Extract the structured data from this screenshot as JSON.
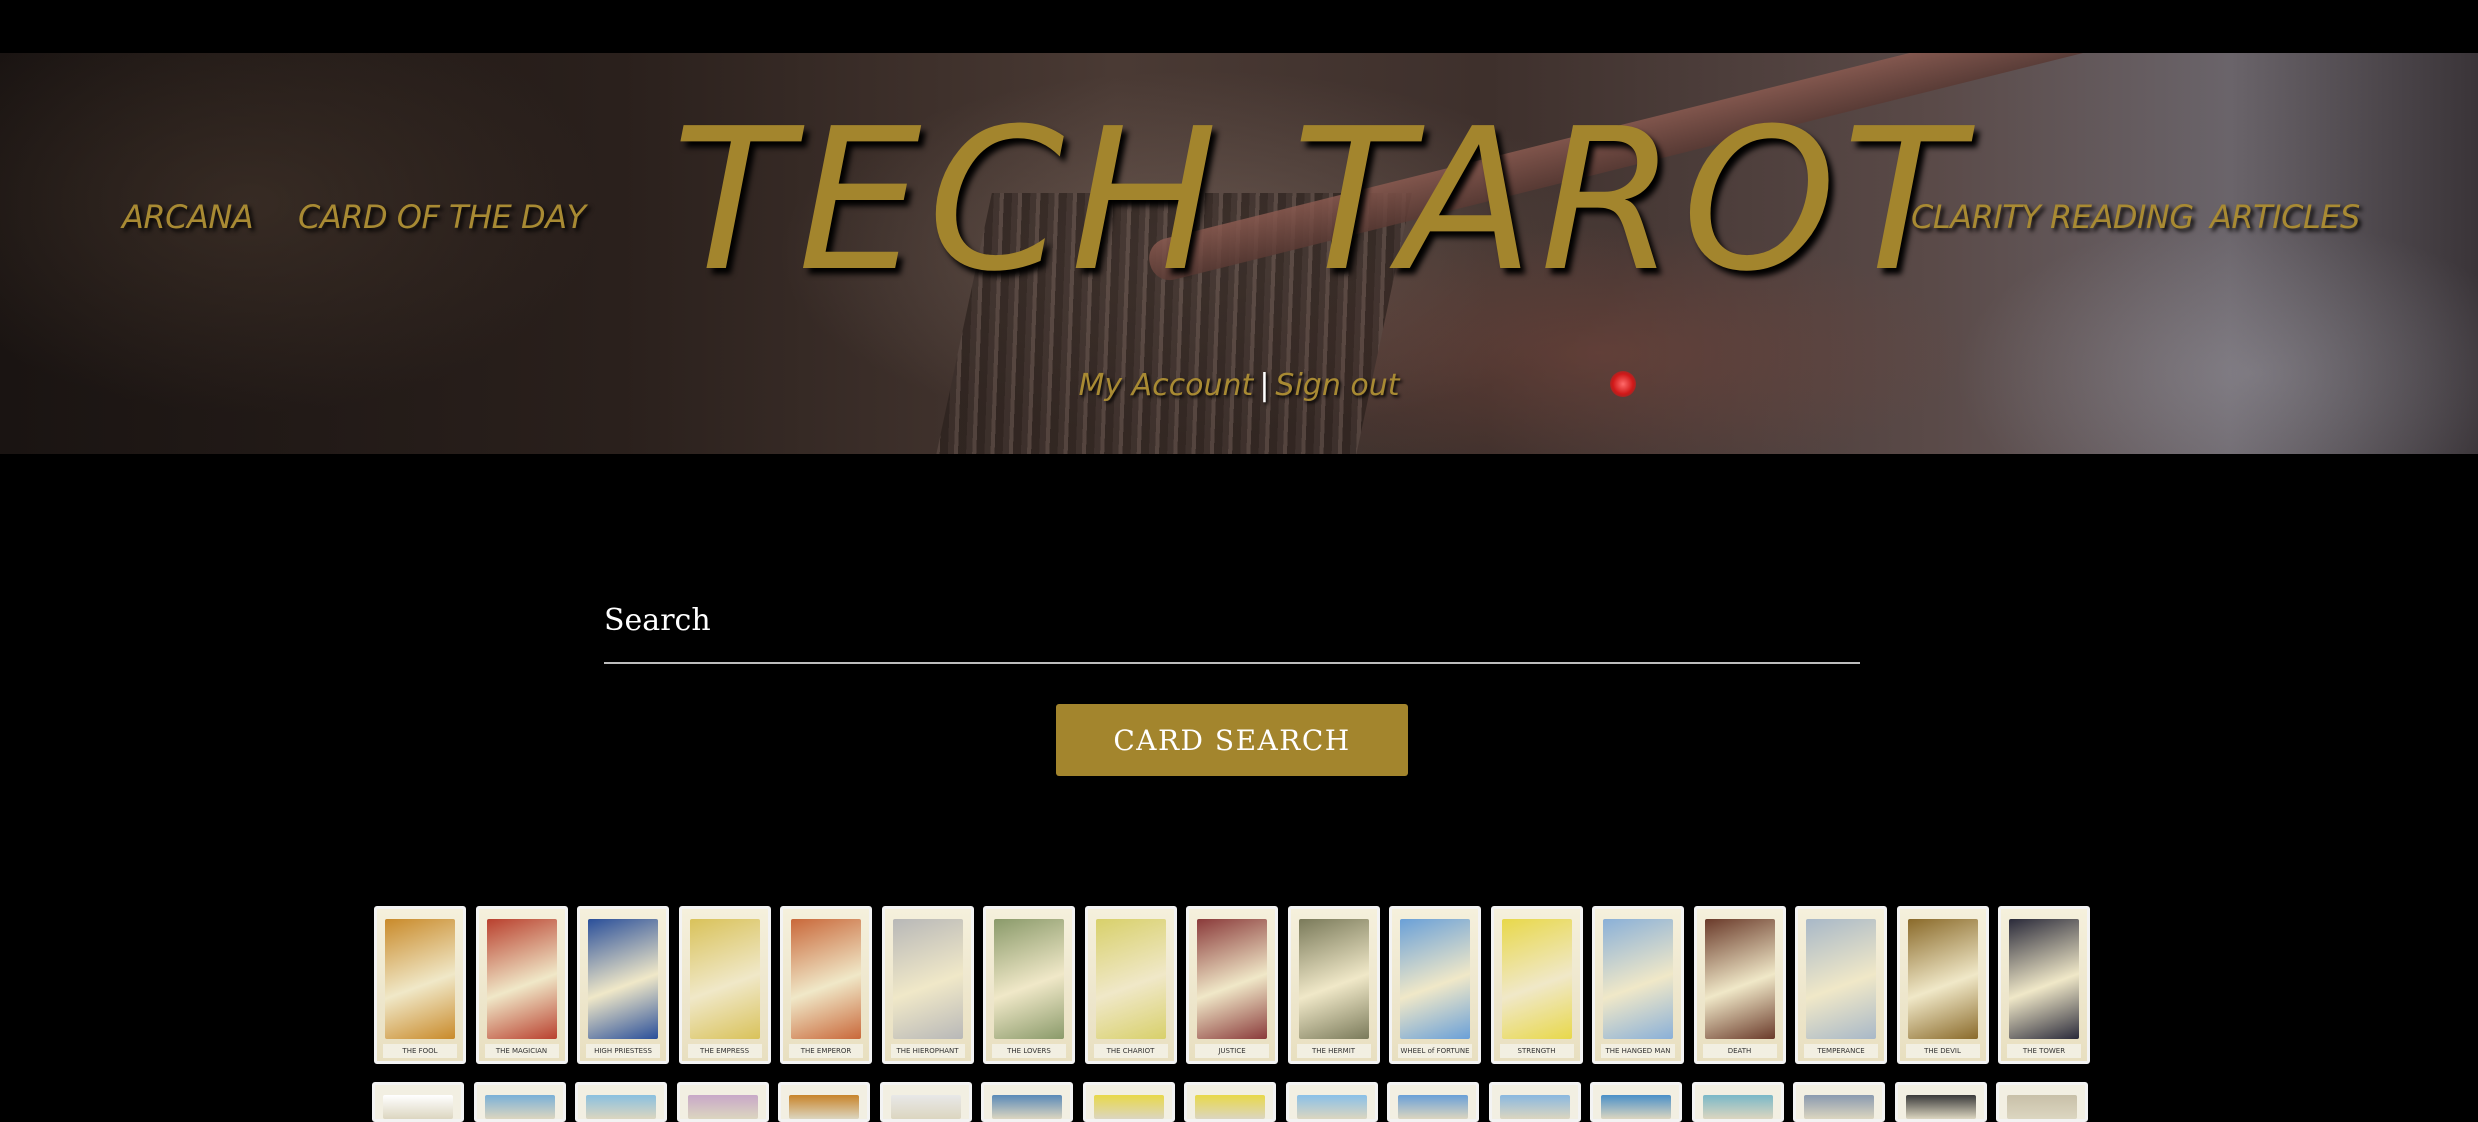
{
  "header": {
    "logo": "TECH TAROT",
    "nav_left": [
      "ARCANA",
      "CARD OF THE DAY"
    ],
    "nav_right": [
      "CLARITY READING",
      "ARTICLES"
    ],
    "account_link": "My Account",
    "account_separator": "|",
    "signout_link": "Sign out"
  },
  "search": {
    "placeholder": "Search",
    "button_label": "CARD SEARCH"
  },
  "colors": {
    "accent": "#a3852d",
    "background": "#000000"
  },
  "cards_row1": [
    {
      "caption": "THE FOOL",
      "tone": "#c98a2a"
    },
    {
      "caption": "THE MAGICIAN",
      "tone": "#b9402e"
    },
    {
      "caption": "HIGH PRIESTESS",
      "tone": "#2a4f9a"
    },
    {
      "caption": "THE EMPRESS",
      "tone": "#d9c25a"
    },
    {
      "caption": "THE EMPEROR",
      "tone": "#c9683a"
    },
    {
      "caption": "THE HIEROPHANT",
      "tone": "#b8b8b8"
    },
    {
      "caption": "THE LOVERS",
      "tone": "#8a9a6a"
    },
    {
      "caption": "THE CHARIOT",
      "tone": "#d8d06a"
    },
    {
      "caption": "JUSTICE",
      "tone": "#8a3a3a"
    },
    {
      "caption": "THE HERMIT",
      "tone": "#7a7a5a"
    },
    {
      "caption": "WHEEL of FORTUNE",
      "tone": "#6aa0d8"
    },
    {
      "caption": "STRENGTH",
      "tone": "#e8d84a"
    },
    {
      "caption": "THE HANGED MAN",
      "tone": "#8ab0d8"
    },
    {
      "caption": "DEATH",
      "tone": "#6a3a2a"
    },
    {
      "caption": "TEMPERANCE",
      "tone": "#a8b8c8"
    },
    {
      "caption": "THE DEVIL",
      "tone": "#8a6a2a"
    },
    {
      "caption": "THE TOWER",
      "tone": "#2a2a3a"
    }
  ],
  "cards_row2": [
    {
      "tone": "#ffffff"
    },
    {
      "tone": "#7ab0d8"
    },
    {
      "tone": "#8ac0e0"
    },
    {
      "tone": "#c8a8c8"
    },
    {
      "tone": "#c8842a"
    },
    {
      "tone": "#e8e8e8"
    },
    {
      "tone": "#5a8ab8"
    },
    {
      "tone": "#e8d84a"
    },
    {
      "tone": "#e8d84a"
    },
    {
      "tone": "#8ac0e8"
    },
    {
      "tone": "#6aa0d8"
    },
    {
      "tone": "#8ab8e0"
    },
    {
      "tone": "#4a90c8"
    },
    {
      "tone": "#7ab8c8"
    },
    {
      "tone": "#8a9ab0"
    },
    {
      "tone": "#3a3a3a"
    },
    {
      "tone": "#c8c0a8"
    }
  ]
}
